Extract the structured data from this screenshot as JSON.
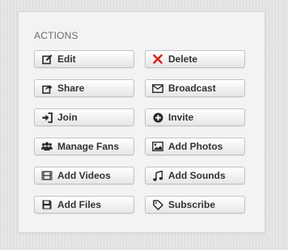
{
  "actions": {
    "title": "ACTIONS",
    "colors": {
      "icon": "#2b2b2b",
      "delete_icon": "#d9261c",
      "text": "#333333"
    },
    "buttons": {
      "edit": {
        "label": "Edit",
        "icon": "edit-icon"
      },
      "delete": {
        "label": "Delete",
        "icon": "close-icon"
      },
      "share": {
        "label": "Share",
        "icon": "share-icon"
      },
      "broadcast": {
        "label": "Broadcast",
        "icon": "envelope-icon"
      },
      "join": {
        "label": "Join",
        "icon": "sign-in-icon"
      },
      "invite": {
        "label": "Invite",
        "icon": "plus-circle-icon"
      },
      "manage_fans": {
        "label": "Manage Fans",
        "icon": "group-icon"
      },
      "add_photos": {
        "label": "Add Photos",
        "icon": "picture-icon"
      },
      "add_videos": {
        "label": "Add Videos",
        "icon": "film-icon"
      },
      "add_sounds": {
        "label": "Add Sounds",
        "icon": "music-icon"
      },
      "add_files": {
        "label": "Add Files",
        "icon": "save-icon"
      },
      "subscribe": {
        "label": "Subscribe",
        "icon": "tag-icon"
      }
    }
  }
}
